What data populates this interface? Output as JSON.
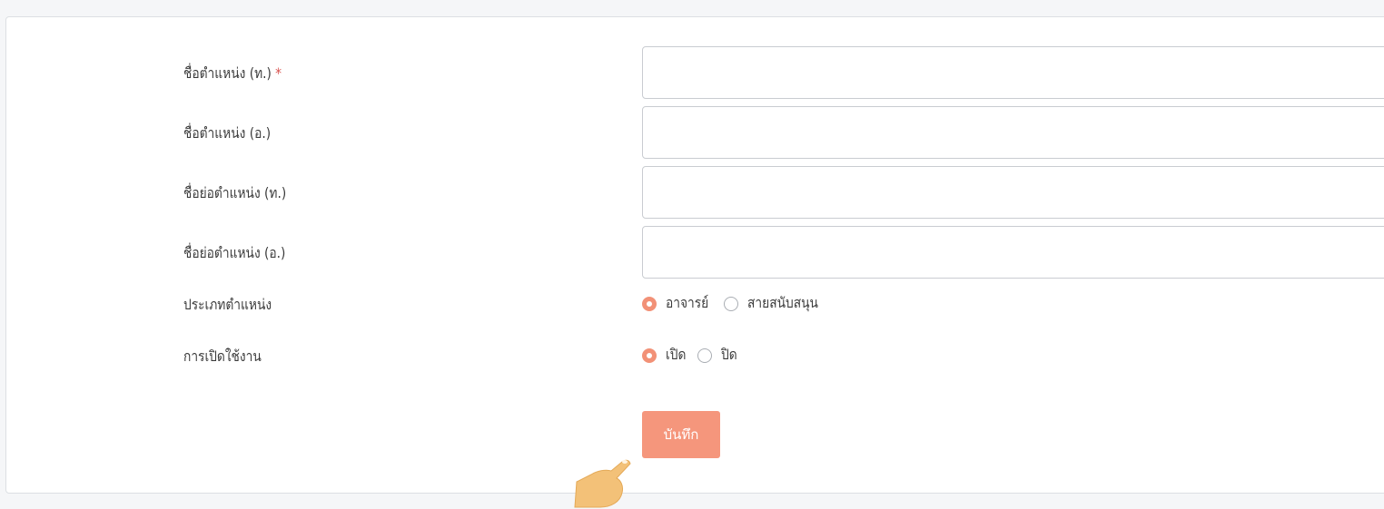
{
  "form": {
    "fields": [
      {
        "label": "ชื่อตำแหน่ง (ท.)",
        "required_mark": "*",
        "value": ""
      },
      {
        "label": "ชื่อตำแหน่ง (อ.)",
        "value": ""
      },
      {
        "label": "ชื่อย่อตำแหน่ง (ท.)",
        "value": ""
      },
      {
        "label": "ชื่อย่อตำแหน่ง (อ.)",
        "value": ""
      }
    ],
    "position_type": {
      "label": "ประเภทตำแหน่ง",
      "options": [
        {
          "label": "อาจารย์",
          "selected": true
        },
        {
          "label": "สายสนับสนุน",
          "selected": false
        }
      ]
    },
    "enabled": {
      "label": "การเปิดใช้งาน",
      "options": [
        {
          "label": "เปิด",
          "selected": true
        },
        {
          "label": "ปิด",
          "selected": false
        }
      ]
    },
    "save_label": "บันทึก"
  },
  "colors": {
    "accent": "#f5967c",
    "radio_selected": "#f29177",
    "required": "#d9534f"
  },
  "icons": {
    "pointer": "hand-pointer-icon"
  }
}
